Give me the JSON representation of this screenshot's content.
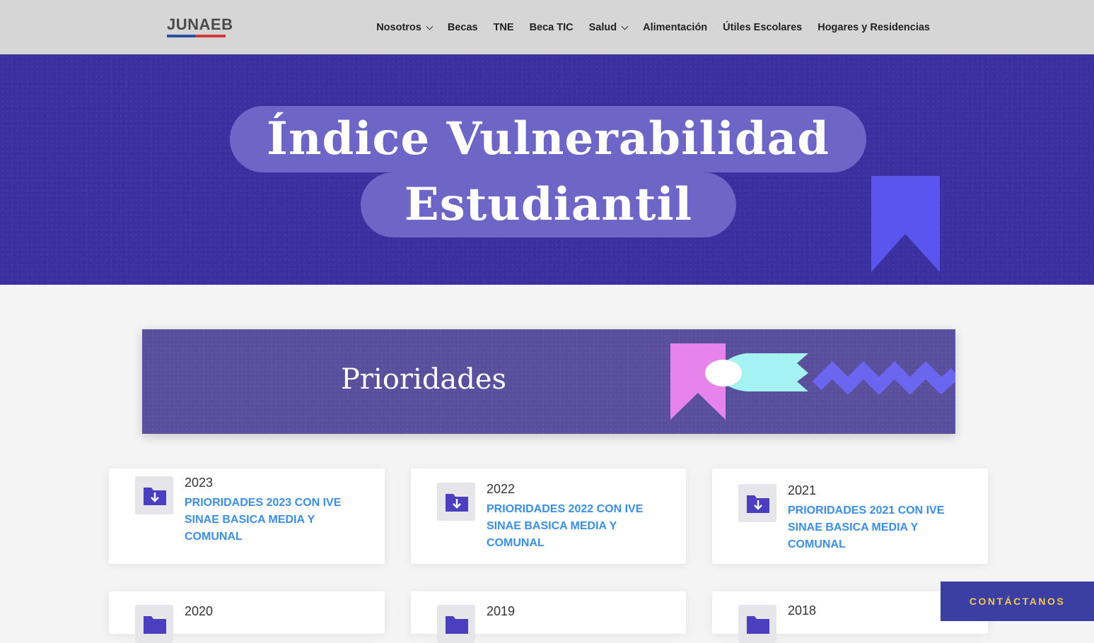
{
  "header": {
    "logo_text": "JUNAEB",
    "nav": [
      {
        "label": "Nosotros",
        "has_dropdown": true
      },
      {
        "label": "Becas",
        "has_dropdown": false
      },
      {
        "label": "TNE",
        "has_dropdown": false
      },
      {
        "label": "Beca TIC",
        "has_dropdown": false
      },
      {
        "label": "Salud",
        "has_dropdown": true
      },
      {
        "label": "Alimentación",
        "has_dropdown": false
      },
      {
        "label": "Útiles Escolares",
        "has_dropdown": false
      },
      {
        "label": "Hogares y Residencias",
        "has_dropdown": false
      }
    ]
  },
  "hero": {
    "title_line1": "Índice Vulnerabilidad",
    "title_line2": "Estudiantil"
  },
  "banner": {
    "title": "Prioridades"
  },
  "cards": [
    {
      "year": "2023",
      "link": "PRIORIDADES 2023 CON IVE SINAE BASICA MEDIA Y COMUNAL",
      "icon": "folder-download-icon"
    },
    {
      "year": "2022",
      "link": "PRIORIDADES 2022 CON IVE SINAE BASICA MEDIA Y COMUNAL",
      "icon": "folder-download-icon"
    },
    {
      "year": "2021",
      "link": "PRIORIDADES 2021 CON IVE SINAE BASICA MEDIA Y COMUNAL",
      "icon": "folder-download-icon"
    },
    {
      "year": "2020",
      "icon": "folder-download-icon"
    },
    {
      "year": "2019",
      "icon": "folder-download-icon"
    },
    {
      "year": "2018",
      "icon": "folder-download-icon"
    }
  ],
  "contact_button": "CONTÁCTANOS",
  "colors": {
    "hero_bg": "#3a30a0",
    "pill": "#6d66c7",
    "banner_bg": "#5a4f9c",
    "link": "#3a8ee6",
    "icon": "#4b3fc0",
    "contact_bg": "#3b3fa3",
    "contact_text": "#f2c84b"
  }
}
